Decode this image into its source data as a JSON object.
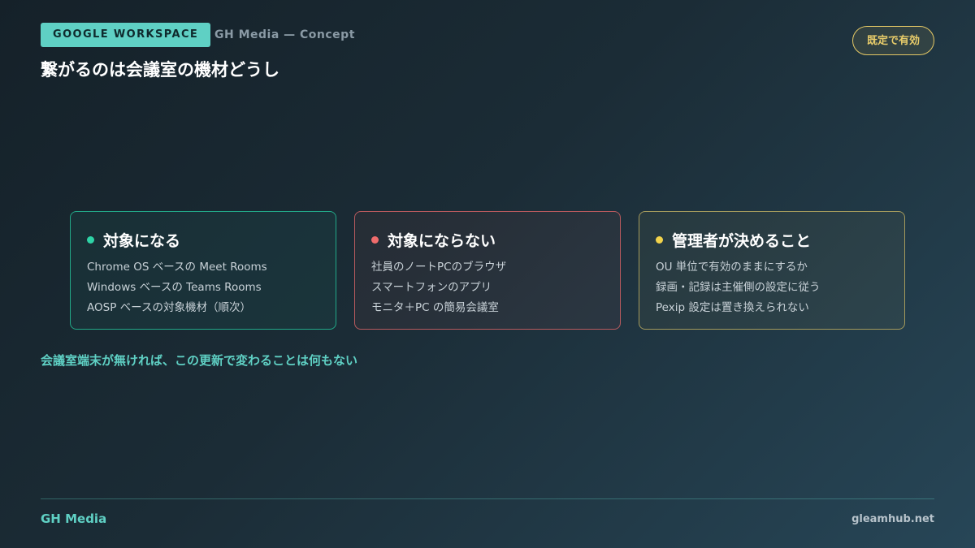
{
  "header": {
    "tag": "GOOGLE WORKSPACE",
    "subtitle": "GH Media — Concept",
    "title": "繋がるのは会議室の機材どうし",
    "status_pill": "既定で有効"
  },
  "cards": [
    {
      "title": "対象になる",
      "dot_color": "#2ed3a6",
      "items": [
        "Chrome OS ベースの Meet Rooms",
        "Windows ベースの Teams Rooms",
        "AOSP ベースの対象機材（順次）"
      ]
    },
    {
      "title": "対象にならない",
      "dot_color": "#ef6c6c",
      "items": [
        "社員のノートPCのブラウザ",
        "スマートフォンのアプリ",
        "モニタ＋PC の簡易会議室"
      ]
    },
    {
      "title": "管理者が決めること",
      "dot_color": "#f2d34b",
      "items": [
        "OU 単位で有効のままにするか",
        "録画・記録は主催側の設定に従う",
        "Pexip 設定は置き換えられない"
      ]
    }
  ],
  "footnote": "会議室端末が無ければ、この更新で変わることは何もない",
  "footer": {
    "brand": "GH Media",
    "site": "gleamhub.net"
  },
  "colors": {
    "accent": "#5fd0c4",
    "highlight": "#e8cc6a"
  }
}
